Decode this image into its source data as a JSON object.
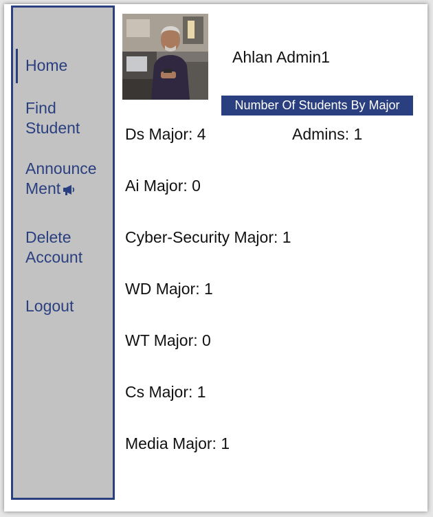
{
  "sidebar": {
    "items": [
      {
        "lines": [
          "Home"
        ]
      },
      {
        "lines": [
          "Find",
          "Student"
        ]
      },
      {
        "lines": [
          "Announce",
          "Ment"
        ],
        "icon": "megaphone-icon"
      },
      {
        "lines": [
          "Delete",
          "Account"
        ]
      },
      {
        "lines": [
          "Logout"
        ]
      }
    ]
  },
  "profile": {
    "greeting": "Ahlan Admin1"
  },
  "stats": {
    "title": "Number Of Students By Major",
    "ds": "Ds Major: 4",
    "admins": "Admins: 1",
    "ai": "Ai Major: 0",
    "cyber": "Cyber-Security Major: 1",
    "wd": "WD Major: 1",
    "wt": "WT Major: 0",
    "cs": "Cs Major: 1",
    "media": "Media Major: 1"
  },
  "colors": {
    "accent": "#2a3f7f",
    "sidebar_bg": "#c2c2c2"
  }
}
